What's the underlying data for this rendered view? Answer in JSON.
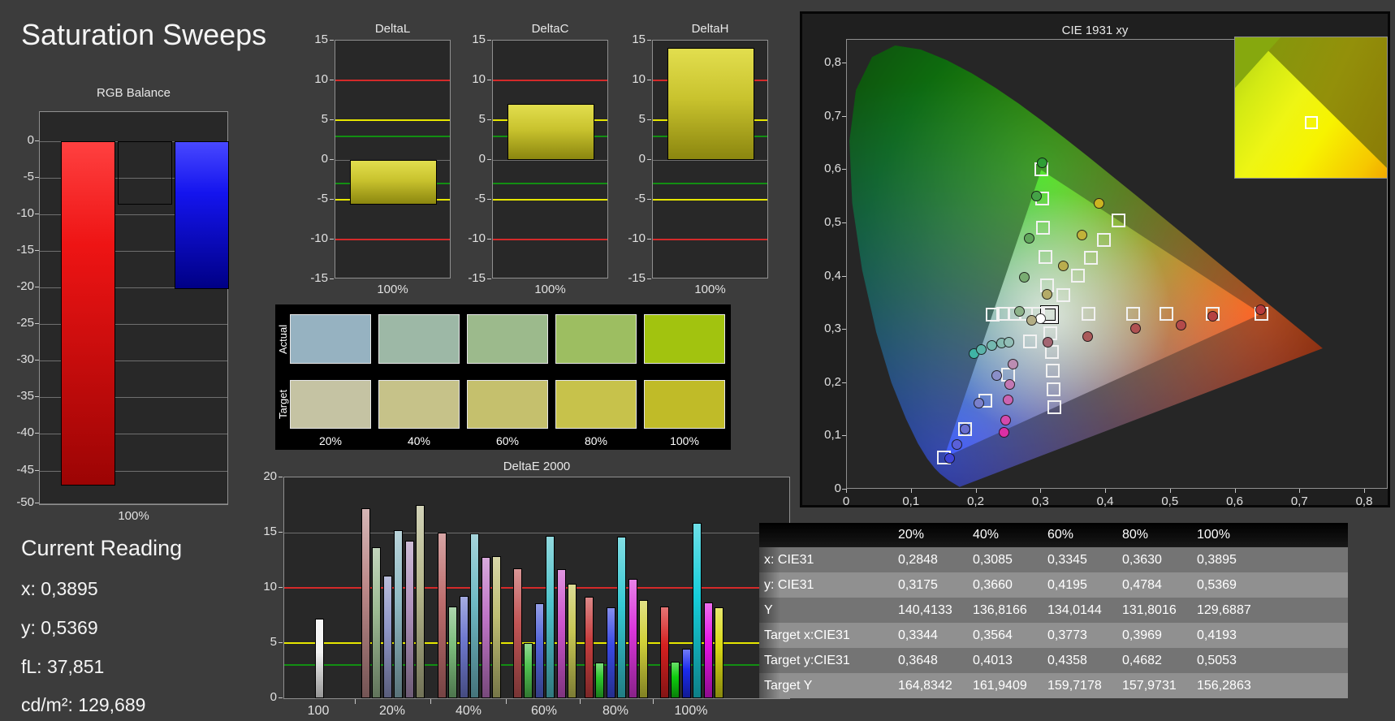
{
  "title": "Saturation Sweeps",
  "current_reading": {
    "heading": "Current Reading",
    "lines": [
      {
        "label": "x:",
        "value": "0,3895"
      },
      {
        "label": "y:",
        "value": "0,5369"
      },
      {
        "label": "fL:",
        "value": "37,851"
      },
      {
        "label": "cd/m²:",
        "value": "129,689"
      }
    ]
  },
  "chart_data": [
    {
      "type": "bar",
      "title": "RGB Balance",
      "xlabel": "100%",
      "ylim": [
        -49.6,
        4.0
      ],
      "yticks": [
        0,
        -5,
        -10,
        -15,
        -20,
        -25,
        -30,
        -35,
        -40,
        -45,
        -50
      ],
      "categories": [
        "Red",
        "Green",
        "Blue"
      ],
      "values": [
        -47.0,
        -8.7,
        -20.2
      ],
      "bar_styles": [
        "bar-red",
        "bar-green",
        "bar-blue"
      ]
    },
    {
      "type": "bar",
      "title_group": [
        "DeltaL",
        "DeltaC",
        "DeltaH"
      ],
      "xlabel": "100%",
      "ylim": [
        -15,
        15
      ],
      "yticks": [
        15,
        10,
        5,
        0,
        -5,
        -10,
        -15
      ],
      "values": [
        -5.6,
        7.0,
        14.1
      ],
      "ref_lines": [
        {
          "y": 10,
          "color": "#d42a2a"
        },
        {
          "y": -10,
          "color": "#d42a2a"
        },
        {
          "y": 5,
          "color": "#e6e600"
        },
        {
          "y": -5,
          "color": "#e6e600"
        },
        {
          "y": 3,
          "color": "#128f12"
        },
        {
          "y": -3,
          "color": "#128f12"
        }
      ]
    },
    {
      "type": "table",
      "name": "color-swatches",
      "row_labels": [
        "Actual",
        "Target"
      ],
      "col_labels": [
        "20%",
        "40%",
        "60%",
        "80%",
        "100%"
      ],
      "actual_colors": [
        "#96b2c1",
        "#9db8a6",
        "#9cba8c",
        "#9dbe61",
        "#a2c30f"
      ],
      "target_colors": [
        "#c5c3a3",
        "#c6c289",
        "#c5c06d",
        "#c7c24b",
        "#c0bb28"
      ]
    },
    {
      "type": "bar",
      "title": "DeltaE 2000",
      "ylim": [
        0,
        20
      ],
      "yticks": [
        20,
        15,
        10,
        5,
        0
      ],
      "ref_lines": [
        {
          "y": 10,
          "color": "#d42a2a"
        },
        {
          "y": 5,
          "color": "#e6e600"
        },
        {
          "y": 3,
          "color": "#128f12"
        }
      ],
      "groups": [
        {
          "label": "100",
          "values": [
            7.2
          ],
          "colors": [
            "#f2f2f2"
          ]
        },
        {
          "label": "20%",
          "values": [
            17.2,
            13.7,
            11.1,
            15.2,
            14.3,
            17.5
          ],
          "colors": [
            "#bb8888",
            "#9cbb93",
            "#8f96c7",
            "#8fb9c3",
            "#b093bd",
            "#b6b78c"
          ]
        },
        {
          "label": "40%",
          "values": [
            15.0,
            8.3,
            9.3,
            14.9,
            12.8,
            12.9
          ],
          "colors": [
            "#bd6d6d",
            "#7cbd7c",
            "#6f79cf",
            "#6fbac5",
            "#bf75c6",
            "#bebe73"
          ]
        },
        {
          "label": "60%",
          "values": [
            11.8,
            5.0,
            8.6,
            14.7,
            11.7,
            10.4
          ],
          "colors": [
            "#c15555",
            "#4fc14f",
            "#5364d9",
            "#4fc3cb",
            "#cc54cc",
            "#c7c754"
          ]
        },
        {
          "label": "80%",
          "values": [
            9.2,
            3.2,
            8.2,
            14.6,
            10.8,
            8.9
          ],
          "colors": [
            "#c73f3f",
            "#2dc72d",
            "#3a4ae3",
            "#36c9d3",
            "#db36db",
            "#d0d03a"
          ]
        },
        {
          "label": "100%",
          "values": [
            8.3,
            3.3,
            4.5,
            15.9,
            8.7,
            8.2
          ],
          "colors": [
            "#d52020",
            "#0ecc0e",
            "#1b2bed",
            "#16cdda",
            "#e514e5",
            "#dada16"
          ]
        }
      ]
    },
    {
      "type": "scatter",
      "title": "CIE 1931 xy",
      "xticks": [
        "0",
        "0,1",
        "0,2",
        "0,3",
        "0,4",
        "0,5",
        "0,6",
        "0,7",
        "0,8"
      ],
      "yticks": [
        "0",
        "0,1",
        "0,2",
        "0,3",
        "0,4",
        "0,5",
        "0,6",
        "0,7",
        "0,8"
      ],
      "gamut_triangle": [
        [
          0.64,
          0.33
        ],
        [
          0.3,
          0.6
        ],
        [
          0.15,
          0.06
        ]
      ],
      "targets": [
        {
          "x": 0.3127,
          "y": 0.329,
          "bold": true
        },
        {
          "x": 0.309,
          "y": 0.384
        },
        {
          "x": 0.306,
          "y": 0.436
        },
        {
          "x": 0.303,
          "y": 0.492
        },
        {
          "x": 0.302,
          "y": 0.546
        },
        {
          "x": 0.3,
          "y": 0.601
        },
        {
          "x": 0.3344,
          "y": 0.3648
        },
        {
          "x": 0.3564,
          "y": 0.4013
        },
        {
          "x": 0.3773,
          "y": 0.4358
        },
        {
          "x": 0.3969,
          "y": 0.4682
        },
        {
          "x": 0.4193,
          "y": 0.5053
        },
        {
          "x": 0.373,
          "y": 0.33
        },
        {
          "x": 0.442,
          "y": 0.33
        },
        {
          "x": 0.494,
          "y": 0.33
        },
        {
          "x": 0.565,
          "y": 0.33
        },
        {
          "x": 0.64,
          "y": 0.33
        },
        {
          "x": 0.295,
          "y": 0.3295
        },
        {
          "x": 0.277,
          "y": 0.3295
        },
        {
          "x": 0.259,
          "y": 0.3295
        },
        {
          "x": 0.241,
          "y": 0.3295
        },
        {
          "x": 0.2246,
          "y": 0.3287
        },
        {
          "x": 0.3144,
          "y": 0.2938
        },
        {
          "x": 0.316,
          "y": 0.258
        },
        {
          "x": 0.3177,
          "y": 0.2227
        },
        {
          "x": 0.3193,
          "y": 0.1884
        },
        {
          "x": 0.3209,
          "y": 0.1542
        },
        {
          "x": 0.2822,
          "y": 0.278
        },
        {
          "x": 0.249,
          "y": 0.216
        },
        {
          "x": 0.214,
          "y": 0.167
        },
        {
          "x": 0.182,
          "y": 0.113
        },
        {
          "x": 0.15,
          "y": 0.06
        }
      ],
      "measurements": [
        {
          "x": 0.2985,
          "y": 0.3215,
          "color": "#ffffff"
        },
        {
          "x": 0.2848,
          "y": 0.3175,
          "color": "#b3ae85"
        },
        {
          "x": 0.3085,
          "y": 0.366,
          "color": "#b4ab68"
        },
        {
          "x": 0.3345,
          "y": 0.4195,
          "color": "#b9ad4e"
        },
        {
          "x": 0.363,
          "y": 0.4784,
          "color": "#c1b239"
        },
        {
          "x": 0.3895,
          "y": 0.5369,
          "color": "#cbb422"
        },
        {
          "x": 0.266,
          "y": 0.334,
          "color": "#8db38a"
        },
        {
          "x": 0.274,
          "y": 0.399,
          "color": "#79ac72"
        },
        {
          "x": 0.282,
          "y": 0.472,
          "color": "#61a75c"
        },
        {
          "x": 0.293,
          "y": 0.551,
          "color": "#45a247"
        },
        {
          "x": 0.301,
          "y": 0.613,
          "color": "#2e9e35"
        },
        {
          "x": 0.372,
          "y": 0.287,
          "color": "#aa5a5a"
        },
        {
          "x": 0.446,
          "y": 0.302,
          "color": "#b05252"
        },
        {
          "x": 0.516,
          "y": 0.308,
          "color": "#b34a4a"
        },
        {
          "x": 0.565,
          "y": 0.325,
          "color": "#b64242"
        },
        {
          "x": 0.639,
          "y": 0.337,
          "color": "#b93a3a"
        },
        {
          "x": 0.196,
          "y": 0.256,
          "color": "#3fb3a5"
        },
        {
          "x": 0.208,
          "y": 0.263,
          "color": "#5bb3aa"
        },
        {
          "x": 0.224,
          "y": 0.271,
          "color": "#74b8b0"
        },
        {
          "x": 0.239,
          "y": 0.275,
          "color": "#86bbb2"
        },
        {
          "x": 0.25,
          "y": 0.277,
          "color": "#92beb7"
        },
        {
          "x": 0.31,
          "y": 0.276,
          "color": "#a36672"
        },
        {
          "x": 0.256,
          "y": 0.236,
          "color": "#bb8db2"
        },
        {
          "x": 0.252,
          "y": 0.197,
          "color": "#c378b4"
        },
        {
          "x": 0.249,
          "y": 0.168,
          "color": "#cb64b1"
        },
        {
          "x": 0.245,
          "y": 0.13,
          "color": "#d44aad"
        },
        {
          "x": 0.243,
          "y": 0.108,
          "color": "#da2fa5"
        },
        {
          "x": 0.231,
          "y": 0.214,
          "color": "#8a8fc9"
        },
        {
          "x": 0.204,
          "y": 0.162,
          "color": "#7a80cb"
        },
        {
          "x": 0.183,
          "y": 0.114,
          "color": "#6a70d2"
        },
        {
          "x": 0.17,
          "y": 0.085,
          "color": "#5a60d8"
        },
        {
          "x": 0.158,
          "y": 0.058,
          "color": "#3f45d8"
        }
      ],
      "minimap_marker": {
        "x_pct": 50.3,
        "y_pct": 60.6
      }
    },
    {
      "type": "table",
      "name": "results-table",
      "columns": [
        "",
        "20%",
        "40%",
        "60%",
        "80%",
        "100%"
      ],
      "rows": [
        {
          "label": "x: CIE31",
          "values": [
            "0,2848",
            "0,3085",
            "0,3345",
            "0,3630",
            "0,3895"
          ]
        },
        {
          "label": "y: CIE31",
          "values": [
            "0,3175",
            "0,3660",
            "0,4195",
            "0,4784",
            "0,5369"
          ]
        },
        {
          "label": "Y",
          "values": [
            "140,4133",
            "136,8166",
            "134,0144",
            "131,8016",
            "129,6887"
          ]
        },
        {
          "label": "Target x:CIE31",
          "values": [
            "0,3344",
            "0,3564",
            "0,3773",
            "0,3969",
            "0,4193"
          ]
        },
        {
          "label": "Target y:CIE31",
          "values": [
            "0,3648",
            "0,4013",
            "0,4358",
            "0,4682",
            "0,5053"
          ]
        },
        {
          "label": "Target Y",
          "values": [
            "164,8342",
            "161,9409",
            "159,7178",
            "157,9731",
            "156,2863"
          ]
        }
      ]
    }
  ]
}
